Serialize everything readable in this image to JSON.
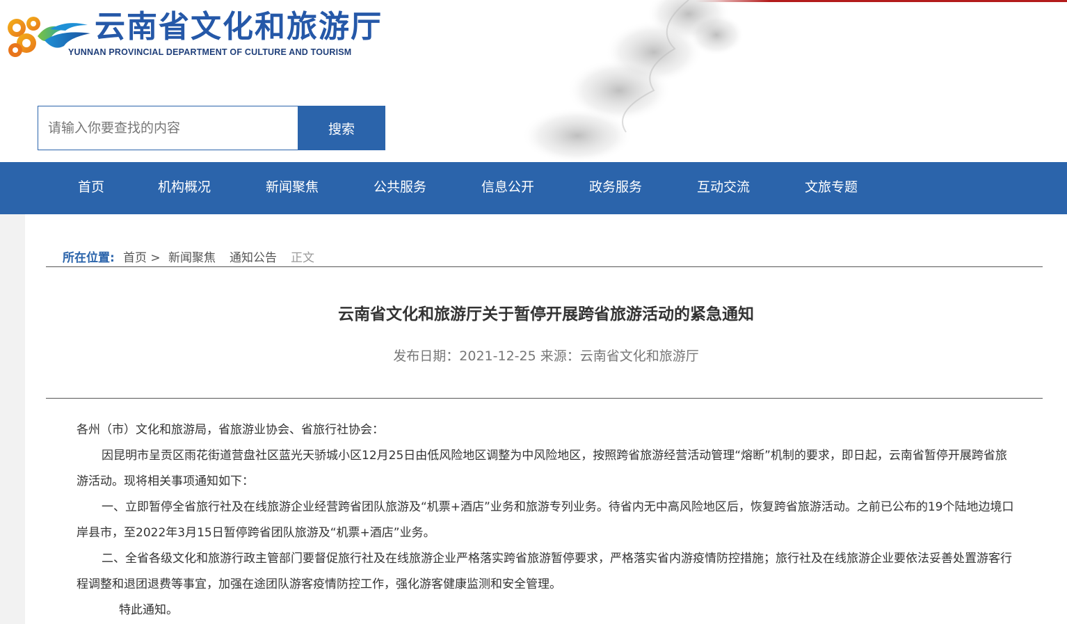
{
  "header": {
    "logo_title": "云南省文化和旅游厅",
    "logo_subtitle": "YUNNAN PROVINCIAL DEPARTMENT OF CULTURE AND TOURISM",
    "logo_icon": "auspicious-cloud-icon",
    "brand_color": "#2b64ab",
    "accent_color": "#b31b1b"
  },
  "search": {
    "placeholder": "请输入你要查找的内容",
    "button_label": "搜索"
  },
  "nav": {
    "items": [
      "首页",
      "机构概况",
      "新闻聚焦",
      "公共服务",
      "信息公开",
      "政务服务",
      "互动交流",
      "文旅专题"
    ]
  },
  "breadcrumb": {
    "label": "所在位置:",
    "home": "首页 >",
    "news": "新闻聚焦",
    "notice": "通知公告",
    "current": "正文"
  },
  "article": {
    "title": "云南省文化和旅游厅关于暂停开展跨省旅游活动的紧急通知",
    "date": "发布日期：2021-12-25",
    "source": "来源：云南省文化和旅游厅",
    "paragraphs": [
      "各州（市）文化和旅游局，省旅游业协会、省旅行社协会：",
      "因昆明市呈贡区雨花街道营盘社区蓝光天骄城小区12月25日由低风险地区调整为中风险地区，按照跨省旅游经营活动管理“熔断”机制的要求，即日起，云南省暂停开展跨省旅游活动。现将相关事项通知如下：",
      "一、立即暂停全省旅行社及在线旅游企业经营跨省团队旅游及“机票+酒店”业务和旅游专列业务。待省内无中高风险地区后，恢复跨省旅游活动。之前已公布的19个陆地边境口岸县市，至2022年3月15日暂停跨省团队旅游及“机票+酒店”业务。",
      "二、全省各级文化和旅游行政主管部门要督促旅行社及在线旅游企业严格落实跨省旅游暂停要求，严格落实省内游疫情防控措施；旅行社及在线旅游企业要依法妥善处置游客行程调整和退团退费等事宜，加强在途团队游客疫情防控工作，强化游客健康监测和安全管理。",
      "特此通知。"
    ]
  }
}
